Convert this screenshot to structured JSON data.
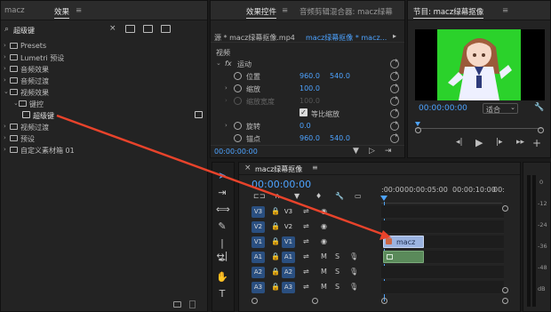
{
  "effects_panel": {
    "tab_project": "macz",
    "tab_effects": "效果",
    "search_value": "超级键",
    "tree": [
      {
        "label": "Presets",
        "level": 0
      },
      {
        "label": "Lumetri 预设",
        "level": 0
      },
      {
        "label": "音频效果",
        "level": 0
      },
      {
        "label": "音频过渡",
        "level": 0
      },
      {
        "label": "视频效果",
        "level": 0,
        "expanded": true
      },
      {
        "label": "键控",
        "level": 1,
        "expanded": true
      },
      {
        "label": "超级键",
        "level": 2,
        "selected": true
      },
      {
        "label": "视频过渡",
        "level": 0
      },
      {
        "label": "预设",
        "level": 0
      },
      {
        "label": "自定义素材箱 01",
        "level": 0
      }
    ]
  },
  "effect_controls": {
    "tab_effect_controls": "效果控件",
    "tab_audio_mixer": "音频剪辑混合器: macz绿幕",
    "source_label": "源 * macz绿幕抠像.mp4",
    "clip_label": "macz绿幕抠像 * macz...",
    "section_video": "视频",
    "motion_label": "运动",
    "fx_label": "fx",
    "position_label": "位置",
    "position_x": "960.0",
    "position_y": "540.0",
    "scale_label": "缩放",
    "scale_value": "100.0",
    "scale_width_label": "缩放宽度",
    "scale_width_value": "100.0",
    "uniform_scale_label": "等比缩放",
    "rotation_label": "旋转",
    "rotation_value": "0.0",
    "anchor_label": "锚点",
    "anchor_x": "960.0",
    "anchor_y": "540.0",
    "timecode": "00:00:00:00"
  },
  "program_monitor": {
    "title": "节目: macz绿幕抠像",
    "timecode": "00:00:00:00",
    "fit_label": "适合",
    "preview_bg_color": "#2bd22b"
  },
  "timeline": {
    "sequence_tab": "macz绿幕抠像",
    "timecode": "00:00:00:00",
    "ruler_labels": [
      ":00:00",
      "00:00:05:00",
      "00:00:10:00",
      "00:"
    ],
    "tracks": [
      {
        "target": "V3",
        "name": "V3",
        "kind": "video"
      },
      {
        "target": "V2",
        "name": "V2",
        "kind": "video"
      },
      {
        "target": "V1",
        "name": "V1",
        "kind": "video",
        "active": true
      },
      {
        "target": "A1",
        "name": "A1",
        "kind": "audio",
        "active": true
      },
      {
        "target": "A2",
        "name": "A2",
        "kind": "audio"
      },
      {
        "target": "A3",
        "name": "A3",
        "kind": "audio"
      }
    ],
    "clip_label": "macz",
    "audio_letters": {
      "m": "M",
      "s": "S"
    }
  },
  "vu_meter": {
    "ticks": [
      "0",
      "-12",
      "-24",
      "-36",
      "-48",
      "dB"
    ]
  },
  "colors": {
    "accent_blue": "#4da3ff",
    "arrow_red": "#e8432b",
    "clip_video": "#9bb3e0",
    "clip_audio": "#5a8a5a"
  }
}
